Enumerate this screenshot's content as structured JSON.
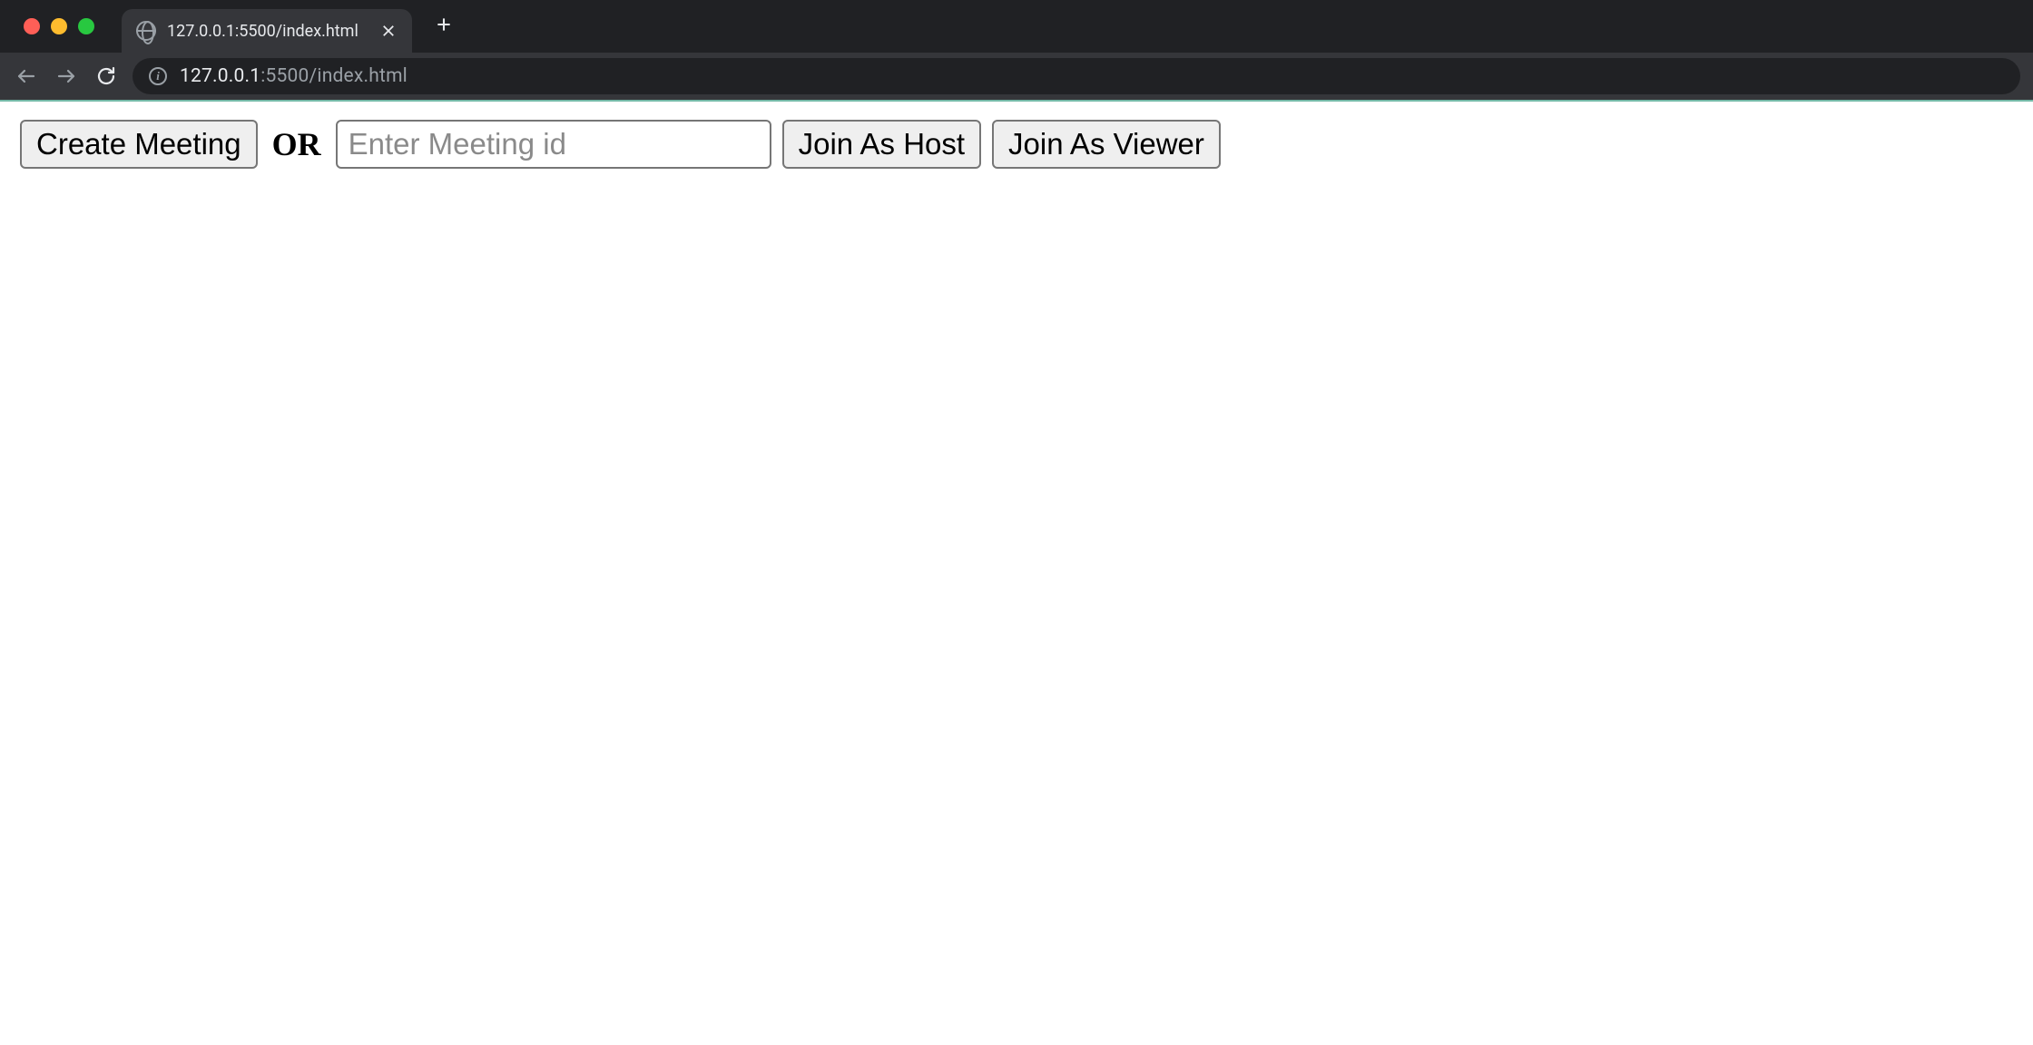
{
  "browser": {
    "tab_title": "127.0.0.1:5500/index.html",
    "address": {
      "host": "127.0.0.1",
      "port_path": ":5500/index.html"
    }
  },
  "page": {
    "create_meeting_label": "Create Meeting",
    "or_label": "OR",
    "meeting_id_placeholder": "Enter Meeting id",
    "meeting_id_value": "",
    "join_host_label": "Join As Host",
    "join_viewer_label": "Join As Viewer"
  }
}
